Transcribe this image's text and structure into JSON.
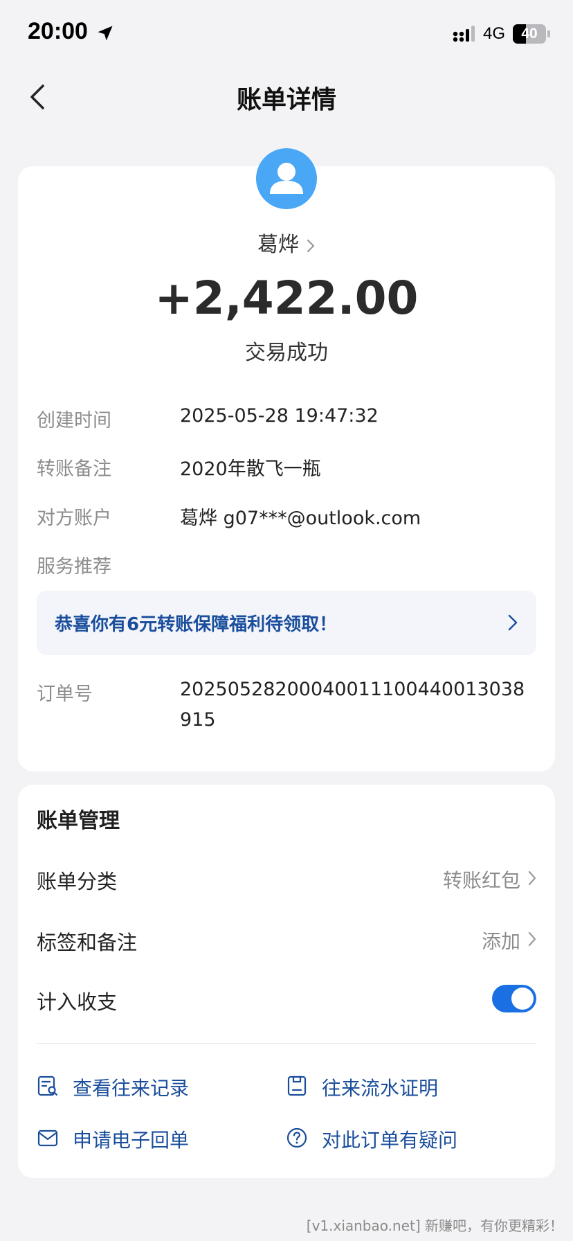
{
  "status_bar": {
    "time": "20:00",
    "network": "4G",
    "battery_level": "40",
    "battery_fraction": 0.4
  },
  "nav": {
    "title": "账单详情"
  },
  "transaction": {
    "payee": "葛烨",
    "amount": "+2,422.00",
    "status": "交易成功"
  },
  "details": {
    "created_label": "创建时间",
    "created_value": "2025-05-28 19:47:32",
    "note_label": "转账备注",
    "note_value": "2020年散飞一瓶",
    "account_label": "对方账户",
    "account_value": "葛烨 g07***@outlook.com",
    "service_label": "服务推荐",
    "promo_text": "恭喜你有6元转账保障福利待领取！",
    "order_label": "订单号",
    "order_value": "20250528200040011100440013038915"
  },
  "manage": {
    "title": "账单管理",
    "category_label": "账单分类",
    "category_value": "转账红包",
    "tags_label": "标签和备注",
    "tags_value": "添加",
    "include_label": "计入收支",
    "include_on": true,
    "actions": [
      {
        "label": "查看往来记录",
        "icon": "record-search-icon"
      },
      {
        "label": "往来流水证明",
        "icon": "statement-icon"
      },
      {
        "label": "申请电子回单",
        "icon": "mail-icon"
      },
      {
        "label": "对此订单有疑问",
        "icon": "question-icon"
      }
    ]
  },
  "watermark": "[v1.xianbao.net] 新赚吧，有你更精彩！",
  "colors": {
    "accent_blue": "#1a6fe3",
    "link_blue": "#1a4e9c",
    "avatar_blue": "#4aa7f5",
    "background": "#f3f3f5"
  }
}
